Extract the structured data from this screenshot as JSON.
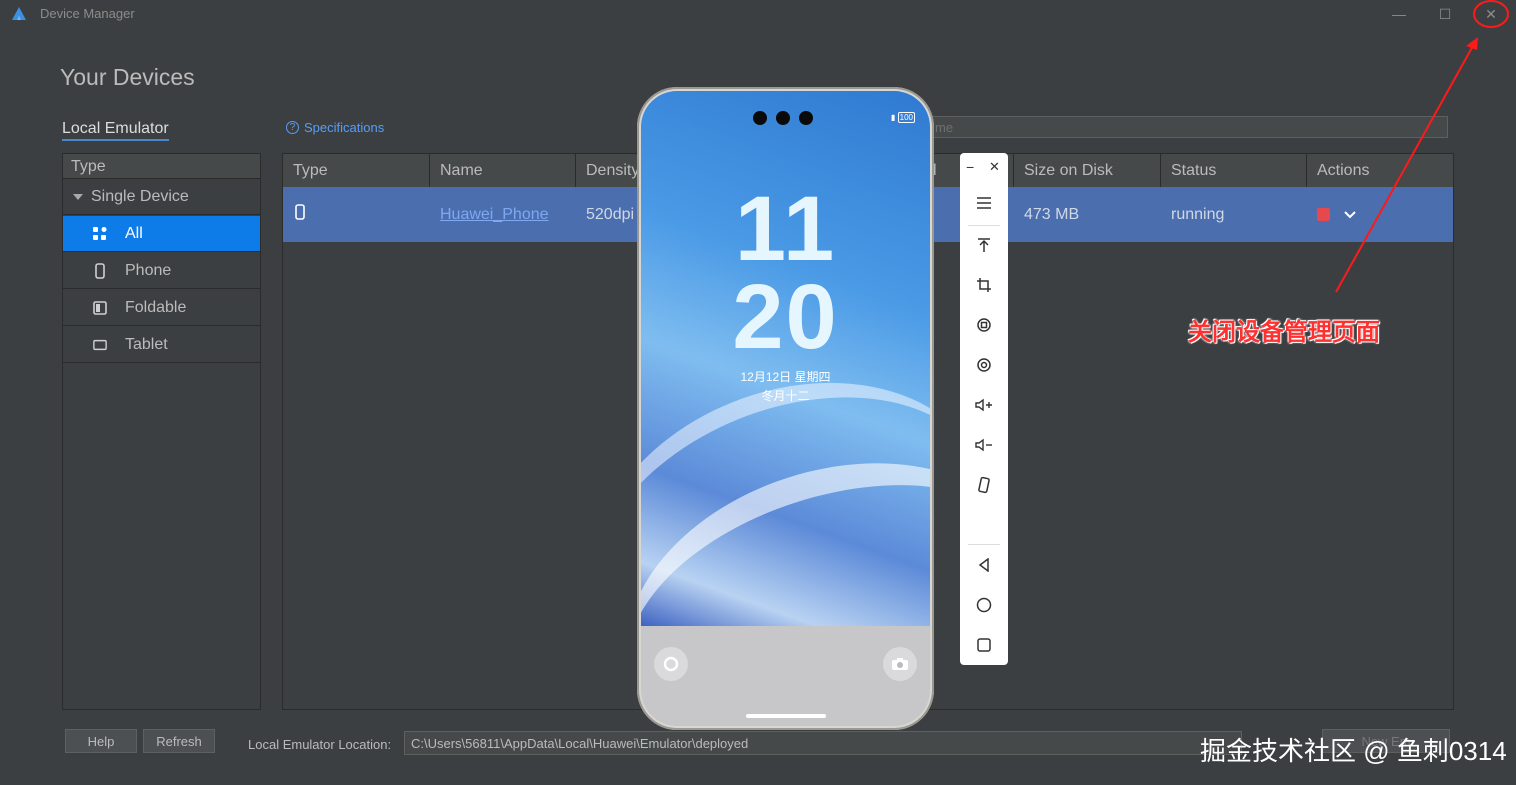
{
  "window": {
    "title": "Device Manager",
    "minimize_glyph": "—",
    "maximize_glyph": "☐",
    "close_glyph": "✕"
  },
  "page": {
    "heading": "Your Devices",
    "tab_local": "Local Emulator",
    "specifications_link": "Specifications",
    "search_placeholder": "me"
  },
  "type_panel": {
    "header": "Type",
    "group": "Single Device",
    "items": [
      {
        "label": "All",
        "icon": "grid-icon",
        "selected": true
      },
      {
        "label": "Phone",
        "icon": "phone-icon",
        "selected": false
      },
      {
        "label": "Foldable",
        "icon": "foldable-icon",
        "selected": false
      },
      {
        "label": "Tablet",
        "icon": "tablet-icon",
        "selected": false
      }
    ]
  },
  "table": {
    "columns": [
      "Type",
      "Name",
      "Density",
      "l",
      "Size on Disk",
      "Status",
      "Actions"
    ],
    "rows": [
      {
        "type_icon": "phone-icon",
        "name": "Huawei_Phone",
        "density": "520dpi",
        "size": "473 MB",
        "status": "running"
      }
    ]
  },
  "bottom": {
    "help_label": "Help",
    "refresh_label": "Refresh",
    "location_label": "Local Emulator Location:",
    "location_value": "C:\\Users\\56811\\AppData\\Local\\Huawei\\Emulator\\deployed",
    "new_emulator_label": "New Em"
  },
  "emulator": {
    "battery": "100",
    "clock_hour": "11",
    "clock_minute": "20",
    "date": "12月12日 星期四",
    "lunar": "冬月十二"
  },
  "toolbar": {
    "minimize_glyph": "−",
    "close_glyph": "✕"
  },
  "annotation": {
    "text": "关闭设备管理页面",
    "color": "#ff3030"
  },
  "watermark": "掘金技术社区 @ 鱼刺0314",
  "colors": {
    "background": "#3c3f41",
    "selection": "#0d7ce8",
    "row_highlight": "#4b6eaf",
    "stop_button": "#e5484d"
  }
}
